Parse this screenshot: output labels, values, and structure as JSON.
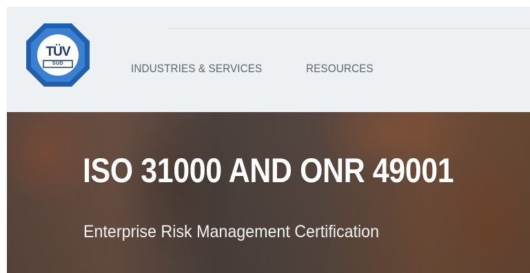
{
  "header": {
    "logo": {
      "main_text": "TÜV",
      "sub_text": "SÜD",
      "icon": "tuv-sud-octagon-logo",
      "colors": {
        "ring": "#1f5fae",
        "inner": "#ffffff",
        "text": "#1b3a6e"
      }
    },
    "nav": [
      {
        "label": "INDUSTRIES & SERVICES"
      },
      {
        "label": "RESOURCES"
      }
    ]
  },
  "hero": {
    "title": "ISO 31000 AND ONR 49001",
    "subtitle": "Enterprise Risk Management Certification"
  }
}
